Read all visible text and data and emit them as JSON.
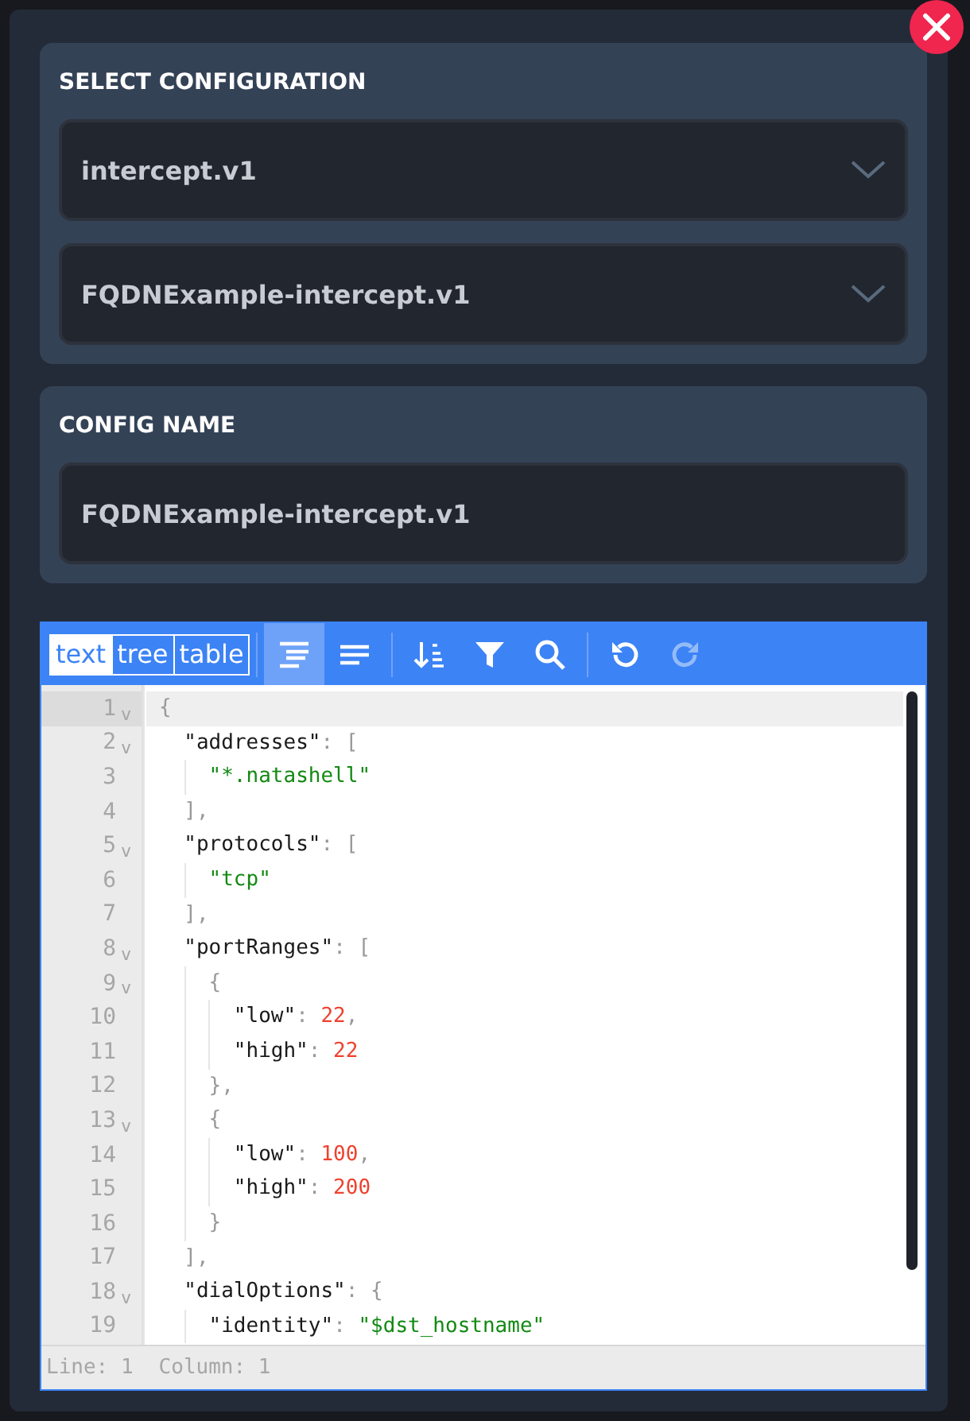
{
  "select_section": {
    "title": "SELECT CONFIGURATION",
    "dropdowns": [
      {
        "value": "intercept.v1"
      },
      {
        "value": "FQDNExample-intercept.v1"
      }
    ]
  },
  "name_section": {
    "title": "CONFIG NAME",
    "field": {
      "value": "FQDNExample-intercept.v1"
    }
  },
  "editor": {
    "modes": [
      {
        "label": "text",
        "selected": true
      },
      {
        "label": "tree",
        "selected": false
      },
      {
        "label": "table",
        "selected": false
      }
    ],
    "tools": [
      [
        {
          "kind": "format",
          "selected": true,
          "disabled": false
        },
        {
          "kind": "compact",
          "selected": false,
          "disabled": false
        }
      ],
      [
        {
          "kind": "sort",
          "selected": false,
          "disabled": false
        },
        {
          "kind": "filter",
          "selected": false,
          "disabled": false
        },
        {
          "kind": "search",
          "selected": false,
          "disabled": false
        }
      ],
      [
        {
          "kind": "undo",
          "selected": false,
          "disabled": false
        },
        {
          "kind": "redo",
          "selected": false,
          "disabled": true
        }
      ]
    ],
    "lines": [
      {
        "number": "1",
        "fold": "v",
        "active": true,
        "tokens": [
          {
            "kind": "punct",
            "text": "{"
          }
        ]
      },
      {
        "number": "2",
        "fold": "v",
        "active": false,
        "tokens": [
          {
            "kind": "key",
            "text": "  \"addresses\""
          },
          {
            "kind": "punct",
            "text": ": ["
          }
        ]
      },
      {
        "number": "3",
        "active": false,
        "tokens": [
          {
            "kind": "string",
            "text": "    \"*.natashell\""
          }
        ]
      },
      {
        "number": "4",
        "active": false,
        "tokens": [
          {
            "kind": "punct",
            "text": "  ],"
          }
        ]
      },
      {
        "number": "5",
        "fold": "v",
        "active": false,
        "tokens": [
          {
            "kind": "key",
            "text": "  \"protocols\""
          },
          {
            "kind": "punct",
            "text": ": ["
          }
        ]
      },
      {
        "number": "6",
        "active": false,
        "tokens": [
          {
            "kind": "string",
            "text": "    \"tcp\""
          }
        ]
      },
      {
        "number": "7",
        "active": false,
        "tokens": [
          {
            "kind": "punct",
            "text": "  ],"
          }
        ]
      },
      {
        "number": "8",
        "fold": "v",
        "active": false,
        "tokens": [
          {
            "kind": "key",
            "text": "  \"portRanges\""
          },
          {
            "kind": "punct",
            "text": ": ["
          }
        ]
      },
      {
        "number": "9",
        "fold": "v",
        "active": false,
        "tokens": [
          {
            "kind": "punct",
            "text": "    {"
          }
        ]
      },
      {
        "number": "10",
        "active": false,
        "tokens": [
          {
            "kind": "key",
            "text": "      \"low\""
          },
          {
            "kind": "punct",
            "text": ": "
          },
          {
            "kind": "number",
            "text": "22"
          },
          {
            "kind": "punct",
            "text": ","
          }
        ]
      },
      {
        "number": "11",
        "active": false,
        "tokens": [
          {
            "kind": "key",
            "text": "      \"high\""
          },
          {
            "kind": "punct",
            "text": ": "
          },
          {
            "kind": "number",
            "text": "22"
          }
        ]
      },
      {
        "number": "12",
        "active": false,
        "tokens": [
          {
            "kind": "punct",
            "text": "    },"
          }
        ]
      },
      {
        "number": "13",
        "fold": "v",
        "active": false,
        "tokens": [
          {
            "kind": "punct",
            "text": "    {"
          }
        ]
      },
      {
        "number": "14",
        "active": false,
        "tokens": [
          {
            "kind": "key",
            "text": "      \"low\""
          },
          {
            "kind": "punct",
            "text": ": "
          },
          {
            "kind": "number",
            "text": "100"
          },
          {
            "kind": "punct",
            "text": ","
          }
        ]
      },
      {
        "number": "15",
        "active": false,
        "tokens": [
          {
            "kind": "key",
            "text": "      \"high\""
          },
          {
            "kind": "punct",
            "text": ": "
          },
          {
            "kind": "number",
            "text": "200"
          }
        ]
      },
      {
        "number": "16",
        "active": false,
        "tokens": [
          {
            "kind": "punct",
            "text": "    }"
          }
        ]
      },
      {
        "number": "17",
        "active": false,
        "tokens": [
          {
            "kind": "punct",
            "text": "  ],"
          }
        ]
      },
      {
        "number": "18",
        "fold": "v",
        "active": false,
        "tokens": [
          {
            "kind": "key",
            "text": "  \"dialOptions\""
          },
          {
            "kind": "punct",
            "text": ": {"
          }
        ]
      },
      {
        "number": "19",
        "active": false,
        "tokens": [
          {
            "kind": "key",
            "text": "    \"identity\""
          },
          {
            "kind": "punct",
            "text": ": "
          },
          {
            "kind": "string",
            "text": "\"$dst_hostname\""
          }
        ]
      }
    ],
    "status": [
      "Line: 1",
      "Column: 1"
    ]
  }
}
